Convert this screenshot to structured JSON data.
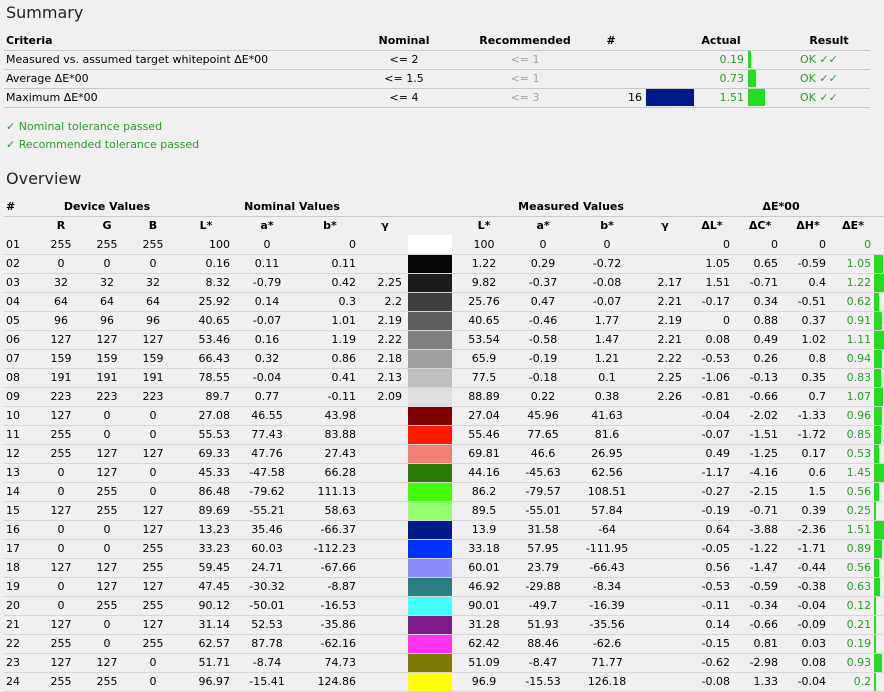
{
  "summary": {
    "title": "Summary",
    "headers": {
      "criteria": "Criteria",
      "nominal": "Nominal",
      "recommended": "Recommended",
      "count": "#",
      "actual": "Actual",
      "result": "Result"
    },
    "rows": [
      {
        "criteria": "Measured vs. assumed target whitepoint ΔE*00",
        "nominal": "<= 2",
        "recommended": "<= 1",
        "count": "",
        "swatch": "",
        "actual": "0.19",
        "bar": 0.19,
        "result": "OK ✓✓"
      },
      {
        "criteria": "Average ΔE*00",
        "nominal": "<= 1.5",
        "recommended": "<= 1",
        "count": "",
        "swatch": "",
        "actual": "0.73",
        "bar": 0.73,
        "result": "OK ✓✓"
      },
      {
        "criteria": "Maximum ΔE*00",
        "nominal": "<= 4",
        "recommended": "<= 3",
        "count": "16",
        "swatch": "#001a8a",
        "actual": "1.51",
        "bar": 1.51,
        "result": "OK ✓✓"
      }
    ],
    "notes": [
      "✓ Nominal tolerance passed",
      "✓ Recommended tolerance passed"
    ]
  },
  "overview": {
    "title": "Overview",
    "group_headers": {
      "idx": "#",
      "device": "Device Values",
      "nominal": "Nominal Values",
      "measured": "Measured Values",
      "delta": "ΔE*00"
    },
    "col_headers": [
      "R",
      "G",
      "B",
      "L*",
      "a*",
      "b*",
      "γ",
      "L*",
      "a*",
      "b*",
      "γ",
      "ΔL*",
      "ΔC*",
      "ΔH*",
      "ΔE*"
    ],
    "rows": [
      {
        "id": "01",
        "r": "255",
        "g": "255",
        "b": "255",
        "nl": "100",
        "na": "0",
        "nb": "0",
        "ng": "",
        "color": "#ffffff",
        "ml": "100",
        "ma": "0",
        "mb": "0",
        "mg": "",
        "dl": "0",
        "dc": "0",
        "dh": "0",
        "de": "0"
      },
      {
        "id": "02",
        "r": "0",
        "g": "0",
        "b": "0",
        "nl": "0.16",
        "na": "0.11",
        "nb": "0.11",
        "ng": "",
        "color": "#060606",
        "ml": "1.22",
        "ma": "0.29",
        "mb": "-0.72",
        "mg": "",
        "dl": "1.05",
        "dc": "0.65",
        "dh": "-0.59",
        "de": "1.05"
      },
      {
        "id": "03",
        "r": "32",
        "g": "32",
        "b": "32",
        "nl": "8.32",
        "na": "-0.79",
        "nb": "0.42",
        "ng": "2.25",
        "color": "#1c1c1c",
        "ml": "9.82",
        "ma": "-0.37",
        "mb": "-0.08",
        "mg": "2.17",
        "dl": "1.51",
        "dc": "-0.71",
        "dh": "0.4",
        "de": "1.22"
      },
      {
        "id": "04",
        "r": "64",
        "g": "64",
        "b": "64",
        "nl": "25.92",
        "na": "0.14",
        "nb": "0.3",
        "ng": "2.2",
        "color": "#3e3e3e",
        "ml": "25.76",
        "ma": "0.47",
        "mb": "-0.07",
        "mg": "2.21",
        "dl": "-0.17",
        "dc": "0.34",
        "dh": "-0.51",
        "de": "0.62"
      },
      {
        "id": "05",
        "r": "96",
        "g": "96",
        "b": "96",
        "nl": "40.65",
        "na": "-0.07",
        "nb": "1.01",
        "ng": "2.19",
        "color": "#5e5e5e",
        "ml": "40.65",
        "ma": "-0.46",
        "mb": "1.77",
        "mg": "2.19",
        "dl": "0",
        "dc": "0.88",
        "dh": "0.37",
        "de": "0.91"
      },
      {
        "id": "06",
        "r": "127",
        "g": "127",
        "b": "127",
        "nl": "53.46",
        "na": "0.16",
        "nb": "1.19",
        "ng": "2.22",
        "color": "#7f7f7f",
        "ml": "53.54",
        "ma": "-0.58",
        "mb": "1.47",
        "mg": "2.21",
        "dl": "0.08",
        "dc": "0.49",
        "dh": "1.02",
        "de": "1.11"
      },
      {
        "id": "07",
        "r": "159",
        "g": "159",
        "b": "159",
        "nl": "66.43",
        "na": "0.32",
        "nb": "0.86",
        "ng": "2.18",
        "color": "#9f9f9f",
        "ml": "65.9",
        "ma": "-0.19",
        "mb": "1.21",
        "mg": "2.22",
        "dl": "-0.53",
        "dc": "0.26",
        "dh": "0.8",
        "de": "0.94"
      },
      {
        "id": "08",
        "r": "191",
        "g": "191",
        "b": "191",
        "nl": "78.55",
        "na": "-0.04",
        "nb": "0.41",
        "ng": "2.13",
        "color": "#bfbfbf",
        "ml": "77.5",
        "ma": "-0.18",
        "mb": "0.1",
        "mg": "2.25",
        "dl": "-1.06",
        "dc": "-0.13",
        "dh": "0.35",
        "de": "0.83"
      },
      {
        "id": "09",
        "r": "223",
        "g": "223",
        "b": "223",
        "nl": "89.7",
        "na": "0.77",
        "nb": "-0.11",
        "ng": "2.09",
        "color": "#dfdfdf",
        "ml": "88.89",
        "ma": "0.22",
        "mb": "0.38",
        "mg": "2.26",
        "dl": "-0.81",
        "dc": "-0.66",
        "dh": "0.7",
        "de": "1.07"
      },
      {
        "id": "10",
        "r": "127",
        "g": "0",
        "b": "0",
        "nl": "27.08",
        "na": "46.55",
        "nb": "43.98",
        "ng": "",
        "color": "#7f0000",
        "ml": "27.04",
        "ma": "45.96",
        "mb": "41.63",
        "mg": "",
        "dl": "-0.04",
        "dc": "-2.02",
        "dh": "-1.33",
        "de": "0.96"
      },
      {
        "id": "11",
        "r": "255",
        "g": "0",
        "b": "0",
        "nl": "55.53",
        "na": "77.43",
        "nb": "83.88",
        "ng": "",
        "color": "#ff1a00",
        "ml": "55.46",
        "ma": "77.65",
        "mb": "81.6",
        "mg": "",
        "dl": "-0.07",
        "dc": "-1.51",
        "dh": "-1.72",
        "de": "0.85"
      },
      {
        "id": "12",
        "r": "255",
        "g": "127",
        "b": "127",
        "nl": "69.33",
        "na": "47.76",
        "nb": "27.43",
        "ng": "",
        "color": "#f08078",
        "ml": "69.81",
        "ma": "46.6",
        "mb": "26.95",
        "mg": "",
        "dl": "0.49",
        "dc": "-1.25",
        "dh": "0.17",
        "de": "0.53"
      },
      {
        "id": "13",
        "r": "0",
        "g": "127",
        "b": "0",
        "nl": "45.33",
        "na": "-47.58",
        "nb": "66.28",
        "ng": "",
        "color": "#2a7a05",
        "ml": "44.16",
        "ma": "-45.63",
        "mb": "62.56",
        "mg": "",
        "dl": "-1.17",
        "dc": "-4.16",
        "dh": "0.6",
        "de": "1.45"
      },
      {
        "id": "14",
        "r": "0",
        "g": "255",
        "b": "0",
        "nl": "86.48",
        "na": "-79.62",
        "nb": "111.13",
        "ng": "",
        "color": "#44ff0a",
        "ml": "86.2",
        "ma": "-79.57",
        "mb": "108.51",
        "mg": "",
        "dl": "-0.27",
        "dc": "-2.15",
        "dh": "1.5",
        "de": "0.56"
      },
      {
        "id": "15",
        "r": "127",
        "g": "255",
        "b": "127",
        "nl": "89.69",
        "na": "-55.21",
        "nb": "58.63",
        "ng": "",
        "color": "#90ff70",
        "ml": "89.5",
        "ma": "-55.01",
        "mb": "57.84",
        "mg": "",
        "dl": "-0.19",
        "dc": "-0.71",
        "dh": "0.39",
        "de": "0.25"
      },
      {
        "id": "16",
        "r": "0",
        "g": "0",
        "b": "127",
        "nl": "13.23",
        "na": "35.46",
        "nb": "-66.37",
        "ng": "",
        "color": "#001a8a",
        "ml": "13.9",
        "ma": "31.58",
        "mb": "-64",
        "mg": "",
        "dl": "0.64",
        "dc": "-3.88",
        "dh": "-2.36",
        "de": "1.51"
      },
      {
        "id": "17",
        "r": "0",
        "g": "0",
        "b": "255",
        "nl": "33.23",
        "na": "60.03",
        "nb": "-112.23",
        "ng": "",
        "color": "#0033ff",
        "ml": "33.18",
        "ma": "57.95",
        "mb": "-111.95",
        "mg": "",
        "dl": "-0.05",
        "dc": "-1.22",
        "dh": "-1.71",
        "de": "0.89"
      },
      {
        "id": "18",
        "r": "127",
        "g": "127",
        "b": "255",
        "nl": "59.45",
        "na": "24.71",
        "nb": "-67.66",
        "ng": "",
        "color": "#8a8cff",
        "ml": "60.01",
        "ma": "23.79",
        "mb": "-66.43",
        "mg": "",
        "dl": "0.56",
        "dc": "-1.47",
        "dh": "-0.44",
        "de": "0.56"
      },
      {
        "id": "19",
        "r": "0",
        "g": "127",
        "b": "127",
        "nl": "47.45",
        "na": "-30.32",
        "nb": "-8.87",
        "ng": "",
        "color": "#2a8080",
        "ml": "46.92",
        "ma": "-29.88",
        "mb": "-8.34",
        "mg": "",
        "dl": "-0.53",
        "dc": "-0.59",
        "dh": "-0.38",
        "de": "0.63"
      },
      {
        "id": "20",
        "r": "0",
        "g": "255",
        "b": "255",
        "nl": "90.12",
        "na": "-50.01",
        "nb": "-16.53",
        "ng": "",
        "color": "#44ffff",
        "ml": "90.01",
        "ma": "-49.7",
        "mb": "-16.39",
        "mg": "",
        "dl": "-0.11",
        "dc": "-0.34",
        "dh": "-0.04",
        "de": "0.12"
      },
      {
        "id": "21",
        "r": "127",
        "g": "0",
        "b": "127",
        "nl": "31.14",
        "na": "52.53",
        "nb": "-35.86",
        "ng": "",
        "color": "#7e1a8a",
        "ml": "31.28",
        "ma": "51.93",
        "mb": "-35.56",
        "mg": "",
        "dl": "0.14",
        "dc": "-0.66",
        "dh": "-0.09",
        "de": "0.21"
      },
      {
        "id": "22",
        "r": "255",
        "g": "0",
        "b": "255",
        "nl": "62.57",
        "na": "87.78",
        "nb": "-62.16",
        "ng": "",
        "color": "#ff33ee",
        "ml": "62.42",
        "ma": "88.46",
        "mb": "-62.6",
        "mg": "",
        "dl": "-0.15",
        "dc": "0.81",
        "dh": "0.03",
        "de": "0.19"
      },
      {
        "id": "23",
        "r": "127",
        "g": "127",
        "b": "0",
        "nl": "51.71",
        "na": "-8.74",
        "nb": "74.73",
        "ng": "",
        "color": "#7f7a05",
        "ml": "51.09",
        "ma": "-8.47",
        "mb": "71.77",
        "mg": "",
        "dl": "-0.62",
        "dc": "-2.98",
        "dh": "0.08",
        "de": "0.93"
      },
      {
        "id": "24",
        "r": "255",
        "g": "255",
        "b": "0",
        "nl": "96.97",
        "na": "-15.41",
        "nb": "124.86",
        "ng": "",
        "color": "#ffff00",
        "ml": "96.9",
        "ma": "-15.53",
        "mb": "126.18",
        "mg": "",
        "dl": "-0.08",
        "dc": "1.33",
        "dh": "-0.04",
        "de": "0.2"
      }
    ]
  }
}
